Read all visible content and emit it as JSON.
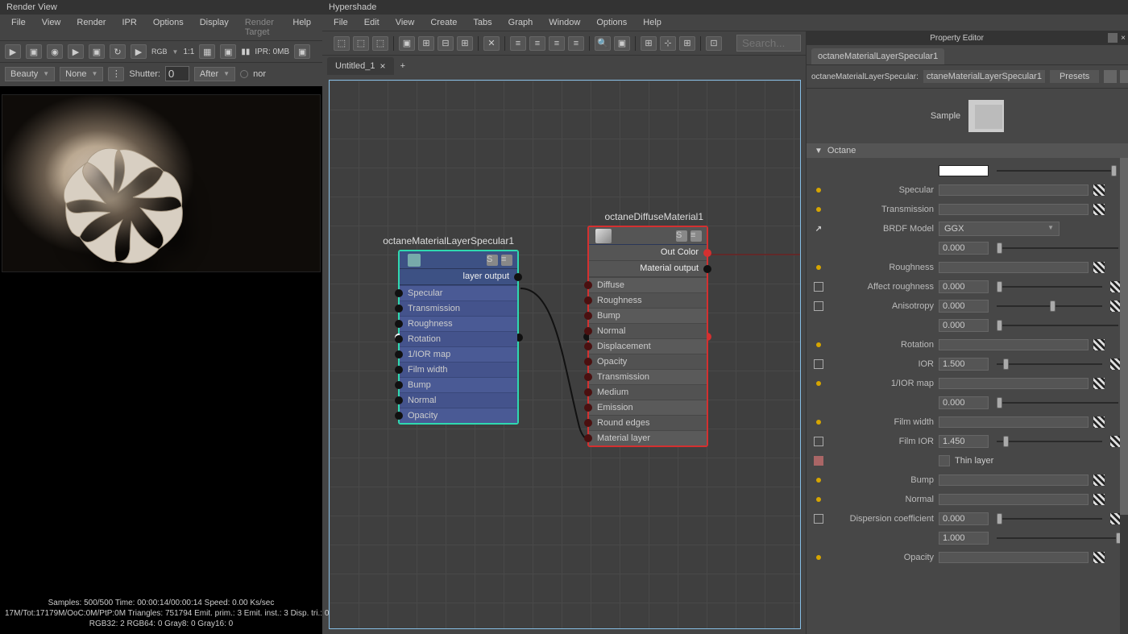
{
  "renderView": {
    "title": "Render View",
    "menu": [
      "File",
      "View",
      "Render",
      "IPR",
      "Options",
      "Display",
      "Render Target",
      "Help"
    ],
    "rgbLabel": "RGB",
    "ratio": "1:1",
    "iprLabel": "IPR: 0MB",
    "tb2": {
      "layer": "Beauty",
      "channel": "None",
      "shutterLabel": "Shutter:",
      "shutterVal": "0",
      "afterLabel": "After",
      "norLabel": "nor"
    },
    "statusText": "Samples: 500/500 Time: 00:00:14/00:00:14 Speed: 0.00 Ks/sec\n17M/Tot:17179M/OoC:0M/PtP:0M Triangles: 751794 Emit. prim.: 3 Emit. inst.: 3 Disp. tri.: 0\nRGB32: 2 RGB64: 0 Gray8: 0 Gray16: 0"
  },
  "hypershade": {
    "title": "Hypershade",
    "menu": [
      "File",
      "Edit",
      "View",
      "Create",
      "Tabs",
      "Graph",
      "Window",
      "Options",
      "Help"
    ],
    "searchPlaceholder": "Search...",
    "tabName": "Untitled_1",
    "nodes": {
      "specular": {
        "title": "octaneMaterialLayerSpecular1",
        "subheader": "layer output",
        "rows": [
          "Specular",
          "Transmission",
          "Roughness",
          "Rotation",
          "1/IOR map",
          "Film width",
          "Bump",
          "Normal",
          "Opacity"
        ]
      },
      "diffuse": {
        "title": "octaneDiffuseMaterial1",
        "sub1": "Out Color",
        "sub2": "Material output",
        "rows": [
          "Diffuse",
          "Roughness",
          "Bump",
          "Normal",
          "Displacement",
          "Opacity",
          "Transmission",
          "Medium",
          "Emission",
          "Round edges",
          "Material layer"
        ]
      }
    }
  },
  "propEditor": {
    "title": "Property Editor",
    "tab": "octaneMaterialLayerSpecular1",
    "typeLabel": "octaneMaterialLayerSpecular:",
    "typeValue": "ctaneMaterialLayerSpecular1",
    "presets": "Presets",
    "sampleLabel": "Sample",
    "sectionTitle": "Octane",
    "rows": {
      "specular": {
        "label": "Specular",
        "color": "#ffffff"
      },
      "transmission": {
        "label": "Transmission"
      },
      "brdf": {
        "label": "BRDF Model",
        "value": "GGX"
      },
      "roughness": {
        "label": "Roughness",
        "value": "0.000",
        "thumb": 0
      },
      "affectRoughness": {
        "label": "Affect roughness",
        "value": "0.000",
        "thumb": 0
      },
      "anisotropy": {
        "label": "Anisotropy",
        "value": "0.000",
        "thumb": 50
      },
      "rotation": {
        "label": "Rotation",
        "value": "0.000",
        "thumb": 0
      },
      "ior": {
        "label": "IOR",
        "value": "1.500",
        "thumb": 6
      },
      "iorMap": {
        "label": "1/IOR map"
      },
      "filmWidth": {
        "label": "Film width",
        "value": "0.000",
        "thumb": 0
      },
      "filmIor": {
        "label": "Film IOR",
        "value": "1.450",
        "thumb": 6
      },
      "thinLayer": {
        "label": "Thin layer"
      },
      "bump": {
        "label": "Bump"
      },
      "normal": {
        "label": "Normal"
      },
      "dispersion": {
        "label": "Dispersion coefficient",
        "value": "0.000",
        "thumb": 0
      },
      "opacity": {
        "label": "Opacity",
        "value": "1.000",
        "thumb": 100
      }
    }
  }
}
